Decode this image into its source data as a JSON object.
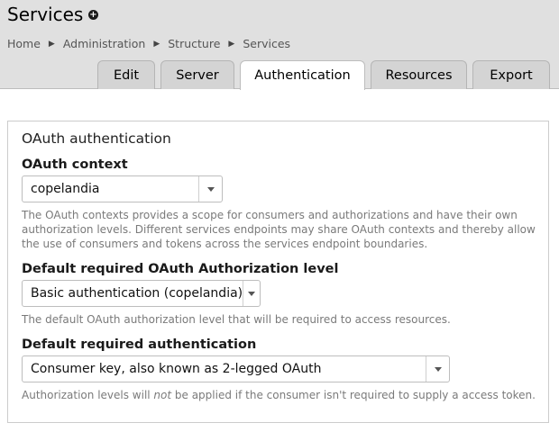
{
  "header": {
    "title": "Services",
    "add_icon": "plus-circle-icon"
  },
  "breadcrumb": [
    "Home",
    "Administration",
    "Structure",
    "Services"
  ],
  "tabs": [
    {
      "label": "Edit",
      "active": false
    },
    {
      "label": "Server",
      "active": false
    },
    {
      "label": "Authentication",
      "active": true
    },
    {
      "label": "Resources",
      "active": false
    },
    {
      "label": "Export",
      "active": false
    }
  ],
  "form": {
    "legend": "OAuth authentication",
    "oauth_context": {
      "label": "OAuth context",
      "value": "copelandia",
      "description": "The OAuth contexts provides a scope for consumers and authorizations and have their own authorization levels. Different services endpoints may share OAuth contexts and thereby allow the use of consumers and tokens across the services endpoint boundaries."
    },
    "authorization_level": {
      "label": "Default required OAuth Authorization level",
      "value": "Basic authentication (copelandia)",
      "description": "The default OAuth authorization level that will be required to access resources."
    },
    "required_authentication": {
      "label": "Default required authentication",
      "value": "Consumer key, also known as 2-legged OAuth",
      "description_before": "Authorization levels will ",
      "description_emphasis": "not",
      "description_after": " be applied if the consumer isn't required to supply a access token."
    }
  },
  "colors": {
    "header_bg": "#e0e0e0",
    "tab_bg": "#d4d4d4",
    "description_text": "#7a7a7a"
  }
}
